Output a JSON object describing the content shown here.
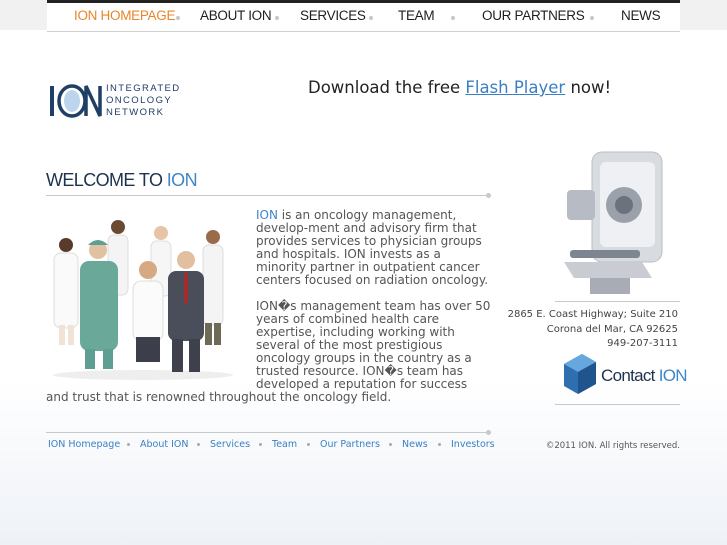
{
  "nav": {
    "items": [
      {
        "label": "ION HOMEPAGE",
        "active": true
      },
      {
        "label": "ABOUT ION"
      },
      {
        "label": "SERVICES"
      },
      {
        "label": "TEAM"
      },
      {
        "label": "OUR PARTNERS"
      },
      {
        "label": "NEWS"
      }
    ]
  },
  "logo": {
    "mark": "ION",
    "lines": [
      "INTEGRATED",
      "ONCOLOGY",
      "NETWORK"
    ]
  },
  "flash": {
    "prefix": "Download the free",
    "link": "Flash Player",
    "suffix": "now!"
  },
  "welcome": {
    "prefix": "WELCOME TO",
    "highlight": "ION"
  },
  "body": {
    "p1_highlight": "ION",
    "p1_text": " is an oncology management, develop-ment and advisory firm that provides services to physician groups and hospitals. ION invests as a minority partner in outpatient cancer centers focused on radiation oncology.",
    "p2_text": "ION�s management team has over 50 years of combined health care expertise, including working with several of the most prestigious oncology groups in the country as a trusted resource. ION�s team has developed a reputation for success and trust that is renowned throughout the oncology field."
  },
  "address": {
    "line1": "2865 E. Coast Highway; Suite 210",
    "line2": "Corona del Mar, CA 92625",
    "phone": "949-207-3111"
  },
  "contact": {
    "prefix": "Contact",
    "highlight": "ION"
  },
  "footer": {
    "links": [
      "ION Homepage",
      "About ION",
      "Services",
      "Team",
      "Our Partners",
      "News",
      "Investors"
    ],
    "copyright": "©2011 ION. All rights reserved."
  },
  "colors": {
    "accent_orange": "#e8862a",
    "link_blue": "#3b7fc4",
    "brand_navy": "#1c3350",
    "highlight_blue": "#3f86c8"
  },
  "icons": [
    "ion-logo-icon",
    "team-photo",
    "linear-accelerator-image",
    "contact-cube-icon"
  ]
}
